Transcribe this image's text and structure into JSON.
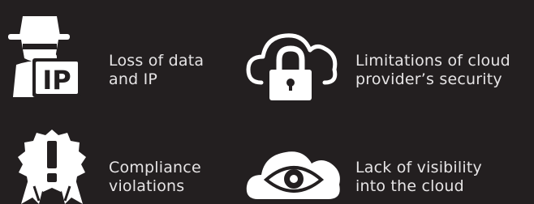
{
  "colors": {
    "background": "#231f20",
    "icon": "#ffffff",
    "text": "#e6e4e5"
  },
  "items": [
    {
      "icon": "spy-with-ip-badge-icon",
      "lines": [
        "Loss of data",
        "and IP"
      ],
      "badge_text": "IP"
    },
    {
      "icon": "cloud-padlock-icon",
      "lines": [
        "Limitations of cloud",
        "provider’s security"
      ]
    },
    {
      "icon": "warning-rosette-icon",
      "lines": [
        "Compliance",
        "violations"
      ]
    },
    {
      "icon": "cloud-eye-icon",
      "lines": [
        "Lack of visibility",
        "into the cloud"
      ]
    }
  ]
}
